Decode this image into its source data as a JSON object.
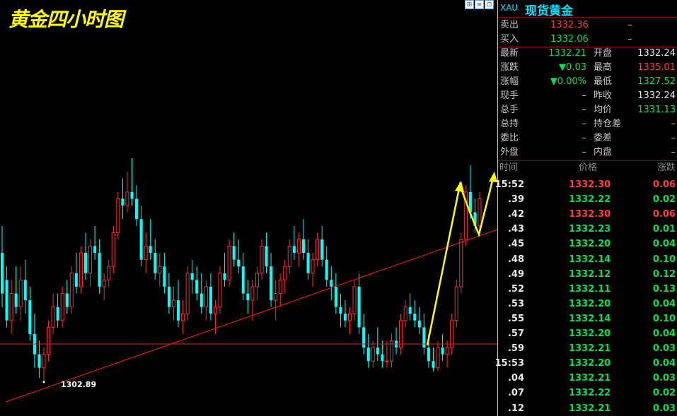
{
  "chart": {
    "title": "黄金四小时图",
    "low_label": "1302.89",
    "window_buttons": [
      "⊞",
      "≡",
      "⊡"
    ]
  },
  "colors": {
    "up": "#ff2b2b",
    "down": "#00ffff",
    "trendline": "#ff1a1a",
    "arrow": "#ffff00",
    "background": "#000000"
  },
  "chart_data": {
    "type": "candlestick",
    "title": "黄金四小时图",
    "annotations": [
      "1302.89"
    ],
    "candles": [
      {
        "o": 1322,
        "h": 1326,
        "l": 1314,
        "c": 1316
      },
      {
        "o": 1318,
        "h": 1320,
        "l": 1311,
        "c": 1312
      },
      {
        "o": 1312,
        "h": 1318,
        "l": 1310,
        "c": 1316
      },
      {
        "o": 1316,
        "h": 1320,
        "l": 1313,
        "c": 1314
      },
      {
        "o": 1314,
        "h": 1320,
        "l": 1312,
        "c": 1318
      },
      {
        "o": 1318,
        "h": 1321,
        "l": 1313,
        "c": 1315
      },
      {
        "o": 1315,
        "h": 1317,
        "l": 1309,
        "c": 1310
      },
      {
        "o": 1310,
        "h": 1313,
        "l": 1305,
        "c": 1307
      },
      {
        "o": 1307,
        "h": 1309,
        "l": 1303.5,
        "c": 1305
      },
      {
        "o": 1305,
        "h": 1308,
        "l": 1302.9,
        "c": 1307
      },
      {
        "o": 1307,
        "h": 1312,
        "l": 1306,
        "c": 1311
      },
      {
        "o": 1311,
        "h": 1316,
        "l": 1310,
        "c": 1314
      },
      {
        "o": 1314,
        "h": 1316,
        "l": 1311,
        "c": 1312
      },
      {
        "o": 1312,
        "h": 1317,
        "l": 1311,
        "c": 1316
      },
      {
        "o": 1316,
        "h": 1318,
        "l": 1313,
        "c": 1314
      },
      {
        "o": 1314,
        "h": 1320,
        "l": 1313,
        "c": 1319
      },
      {
        "o": 1319,
        "h": 1322,
        "l": 1316,
        "c": 1317
      },
      {
        "o": 1317,
        "h": 1323,
        "l": 1316,
        "c": 1322
      },
      {
        "o": 1322,
        "h": 1325,
        "l": 1318,
        "c": 1319
      },
      {
        "o": 1319,
        "h": 1324,
        "l": 1317,
        "c": 1323
      },
      {
        "o": 1323,
        "h": 1326,
        "l": 1321,
        "c": 1322
      },
      {
        "o": 1322,
        "h": 1324,
        "l": 1316,
        "c": 1317
      },
      {
        "o": 1317,
        "h": 1319,
        "l": 1315,
        "c": 1318
      },
      {
        "o": 1318,
        "h": 1321,
        "l": 1317,
        "c": 1320
      },
      {
        "o": 1320,
        "h": 1326,
        "l": 1319,
        "c": 1325
      },
      {
        "o": 1325,
        "h": 1331,
        "l": 1324,
        "c": 1330
      },
      {
        "o": 1330,
        "h": 1333,
        "l": 1327,
        "c": 1329
      },
      {
        "o": 1329,
        "h": 1334,
        "l": 1328,
        "c": 1331
      },
      {
        "o": 1331,
        "h": 1336,
        "l": 1329,
        "c": 1330
      },
      {
        "o": 1330,
        "h": 1332,
        "l": 1326,
        "c": 1327
      },
      {
        "o": 1327,
        "h": 1329,
        "l": 1320,
        "c": 1321
      },
      {
        "o": 1321,
        "h": 1325,
        "l": 1319,
        "c": 1323
      },
      {
        "o": 1323,
        "h": 1327,
        "l": 1321,
        "c": 1322
      },
      {
        "o": 1322,
        "h": 1324,
        "l": 1318,
        "c": 1319
      },
      {
        "o": 1319,
        "h": 1322,
        "l": 1317,
        "c": 1320
      },
      {
        "o": 1320,
        "h": 1322,
        "l": 1316,
        "c": 1317
      },
      {
        "o": 1317,
        "h": 1319,
        "l": 1313,
        "c": 1314
      },
      {
        "o": 1314,
        "h": 1317,
        "l": 1312,
        "c": 1315
      },
      {
        "o": 1315,
        "h": 1318,
        "l": 1311,
        "c": 1312
      },
      {
        "o": 1312,
        "h": 1315,
        "l": 1310,
        "c": 1313
      },
      {
        "o": 1313,
        "h": 1320,
        "l": 1312,
        "c": 1319
      },
      {
        "o": 1319,
        "h": 1321,
        "l": 1316,
        "c": 1318
      },
      {
        "o": 1318,
        "h": 1320,
        "l": 1315,
        "c": 1316
      },
      {
        "o": 1316,
        "h": 1319,
        "l": 1313,
        "c": 1314
      },
      {
        "o": 1314,
        "h": 1318,
        "l": 1312,
        "c": 1317
      },
      {
        "o": 1317,
        "h": 1319,
        "l": 1312,
        "c": 1313
      },
      {
        "o": 1313,
        "h": 1315,
        "l": 1310,
        "c": 1314
      },
      {
        "o": 1314,
        "h": 1320,
        "l": 1313,
        "c": 1319
      },
      {
        "o": 1319,
        "h": 1322,
        "l": 1317,
        "c": 1318
      },
      {
        "o": 1318,
        "h": 1324,
        "l": 1317,
        "c": 1323
      },
      {
        "o": 1323,
        "h": 1325,
        "l": 1320,
        "c": 1321
      },
      {
        "o": 1321,
        "h": 1324,
        "l": 1319,
        "c": 1320
      },
      {
        "o": 1320,
        "h": 1322,
        "l": 1315,
        "c": 1316
      },
      {
        "o": 1316,
        "h": 1318,
        "l": 1313,
        "c": 1315
      },
      {
        "o": 1315,
        "h": 1318,
        "l": 1312,
        "c": 1317
      },
      {
        "o": 1317,
        "h": 1320,
        "l": 1315,
        "c": 1319
      },
      {
        "o": 1319,
        "h": 1324,
        "l": 1318,
        "c": 1323
      },
      {
        "o": 1323,
        "h": 1325,
        "l": 1319,
        "c": 1320
      },
      {
        "o": 1320,
        "h": 1322,
        "l": 1314,
        "c": 1315
      },
      {
        "o": 1315,
        "h": 1318,
        "l": 1312,
        "c": 1316
      },
      {
        "o": 1316,
        "h": 1319,
        "l": 1314,
        "c": 1318
      },
      {
        "o": 1318,
        "h": 1321,
        "l": 1316,
        "c": 1320
      },
      {
        "o": 1320,
        "h": 1324,
        "l": 1319,
        "c": 1323
      },
      {
        "o": 1323,
        "h": 1326,
        "l": 1321,
        "c": 1322
      },
      {
        "o": 1322,
        "h": 1325,
        "l": 1320,
        "c": 1324
      },
      {
        "o": 1324,
        "h": 1327,
        "l": 1321,
        "c": 1322
      },
      {
        "o": 1322,
        "h": 1324,
        "l": 1318,
        "c": 1319
      },
      {
        "o": 1319,
        "h": 1322,
        "l": 1317,
        "c": 1321
      },
      {
        "o": 1321,
        "h": 1325,
        "l": 1320,
        "c": 1324
      },
      {
        "o": 1324,
        "h": 1326,
        "l": 1320,
        "c": 1321
      },
      {
        "o": 1321,
        "h": 1323,
        "l": 1317,
        "c": 1318
      },
      {
        "o": 1318,
        "h": 1320,
        "l": 1315,
        "c": 1317
      },
      {
        "o": 1317,
        "h": 1319,
        "l": 1313,
        "c": 1314
      },
      {
        "o": 1314,
        "h": 1316,
        "l": 1311,
        "c": 1313
      },
      {
        "o": 1313,
        "h": 1315,
        "l": 1311,
        "c": 1312
      },
      {
        "o": 1312,
        "h": 1314,
        "l": 1310,
        "c": 1313
      },
      {
        "o": 1313,
        "h": 1318,
        "l": 1312,
        "c": 1317
      },
      {
        "o": 1317,
        "h": 1319,
        "l": 1310,
        "c": 1311
      },
      {
        "o": 1311,
        "h": 1313,
        "l": 1307,
        "c": 1308
      },
      {
        "o": 1308,
        "h": 1310,
        "l": 1305,
        "c": 1306
      },
      {
        "o": 1306,
        "h": 1309,
        "l": 1305,
        "c": 1308
      },
      {
        "o": 1308,
        "h": 1311,
        "l": 1306,
        "c": 1307
      },
      {
        "o": 1307,
        "h": 1309,
        "l": 1305,
        "c": 1306
      },
      {
        "o": 1306,
        "h": 1309,
        "l": 1305,
        "c": 1306
      },
      {
        "o": 1306,
        "h": 1310,
        "l": 1305,
        "c": 1309
      },
      {
        "o": 1309,
        "h": 1311,
        "l": 1307,
        "c": 1308
      },
      {
        "o": 1308,
        "h": 1313,
        "l": 1307,
        "c": 1312
      },
      {
        "o": 1312,
        "h": 1315,
        "l": 1311,
        "c": 1314
      },
      {
        "o": 1314,
        "h": 1316,
        "l": 1312,
        "c": 1313
      },
      {
        "o": 1313,
        "h": 1315,
        "l": 1311,
        "c": 1312
      },
      {
        "o": 1312,
        "h": 1314,
        "l": 1310,
        "c": 1311
      },
      {
        "o": 1311,
        "h": 1313,
        "l": 1307,
        "c": 1308
      },
      {
        "o": 1308,
        "h": 1310,
        "l": 1305,
        "c": 1306
      },
      {
        "o": 1306,
        "h": 1308,
        "l": 1304.5,
        "c": 1305
      },
      {
        "o": 1305,
        "h": 1309,
        "l": 1304.5,
        "c": 1308
      },
      {
        "o": 1308,
        "h": 1310,
        "l": 1306,
        "c": 1307
      },
      {
        "o": 1307,
        "h": 1309,
        "l": 1305,
        "c": 1308
      },
      {
        "o": 1308,
        "h": 1313,
        "l": 1307,
        "c": 1312
      },
      {
        "o": 1312,
        "h": 1318,
        "l": 1311,
        "c": 1317
      },
      {
        "o": 1317,
        "h": 1325,
        "l": 1316,
        "c": 1324
      },
      {
        "o": 1324,
        "h": 1332,
        "l": 1323,
        "c": 1331
      },
      {
        "o": 1331,
        "h": 1335,
        "l": 1327,
        "c": 1328
      },
      {
        "o": 1328,
        "h": 1330,
        "l": 1325,
        "c": 1326
      },
      {
        "o": 1326,
        "h": 1331,
        "l": 1325,
        "c": 1330
      }
    ],
    "support_level": 1306,
    "xlabel": "",
    "ylabel": ""
  },
  "panel": {
    "code": "XAU",
    "name": "现货黄金",
    "sell": {
      "label": "卖出",
      "price": "1332.36",
      "vol": "–"
    },
    "buy": {
      "label": "买入",
      "price": "1332.06",
      "vol": "–"
    },
    "stats": [
      {
        "l1": "最新",
        "v1": "1332.21",
        "c1": "green",
        "l2": "开盘",
        "v2": "1332.24",
        "c2": "white"
      },
      {
        "l1": "涨跌",
        "v1": "▼0.03",
        "c1": "green",
        "l2": "最高",
        "v2": "1335.01",
        "c2": "red"
      },
      {
        "l1": "涨幅",
        "v1": "▼0.00%",
        "c1": "green",
        "l2": "最低",
        "v2": "1327.52",
        "c2": "green"
      },
      {
        "l1": "现手",
        "v1": "–",
        "c1": "dash",
        "l2": "昨收",
        "v2": "1332.24",
        "c2": "white"
      },
      {
        "l1": "总手",
        "v1": "–",
        "c1": "dash",
        "l2": "均价",
        "v2": "1331.13",
        "c2": "green"
      },
      {
        "l1": "总持",
        "v1": "–",
        "c1": "dash",
        "l2": "持仓差",
        "v2": "–",
        "c2": "dash"
      },
      {
        "l1": "委比",
        "v1": "–",
        "c1": "dash",
        "l2": "委差",
        "v2": "–",
        "c2": "dash"
      },
      {
        "l1": "外盘",
        "v1": "–",
        "c1": "dash",
        "l2": "内盘",
        "v2": "–",
        "c2": "dash"
      }
    ],
    "ticks_header": {
      "time": "时间",
      "price": "价格",
      "change": "涨跌"
    },
    "ticks": [
      {
        "time": "15:52",
        "price": "1332.30",
        "change": "0.06",
        "color": "red"
      },
      {
        "time": ".39",
        "price": "1332.22",
        "change": "0.02",
        "color": "green"
      },
      {
        "time": ".42",
        "price": "1332.30",
        "change": "0.06",
        "color": "red"
      },
      {
        "time": ".43",
        "price": "1332.23",
        "change": "0.01",
        "color": "green"
      },
      {
        "time": ".45",
        "price": "1332.20",
        "change": "0.04",
        "color": "green"
      },
      {
        "time": ".48",
        "price": "1332.14",
        "change": "0.10",
        "color": "green"
      },
      {
        "time": ".49",
        "price": "1332.12",
        "change": "0.12",
        "color": "green"
      },
      {
        "time": ".52",
        "price": "1332.11",
        "change": "0.13",
        "color": "green"
      },
      {
        "time": ".53",
        "price": "1332.20",
        "change": "0.04",
        "color": "green"
      },
      {
        "time": ".55",
        "price": "1332.14",
        "change": "0.10",
        "color": "green"
      },
      {
        "time": ".57",
        "price": "1332.20",
        "change": "0.04",
        "color": "green"
      },
      {
        "time": ".59",
        "price": "1332.21",
        "change": "0.03",
        "color": "green"
      },
      {
        "time": "15:53",
        "price": "1332.20",
        "change": "0.04",
        "color": "green"
      },
      {
        "time": ".04",
        "price": "1332.21",
        "change": "0.03",
        "color": "green"
      },
      {
        "time": ".07",
        "price": "1332.22",
        "change": "0.02",
        "color": "green"
      },
      {
        "time": ".12",
        "price": "1332.21",
        "change": "0.03",
        "color": "green"
      }
    ]
  }
}
